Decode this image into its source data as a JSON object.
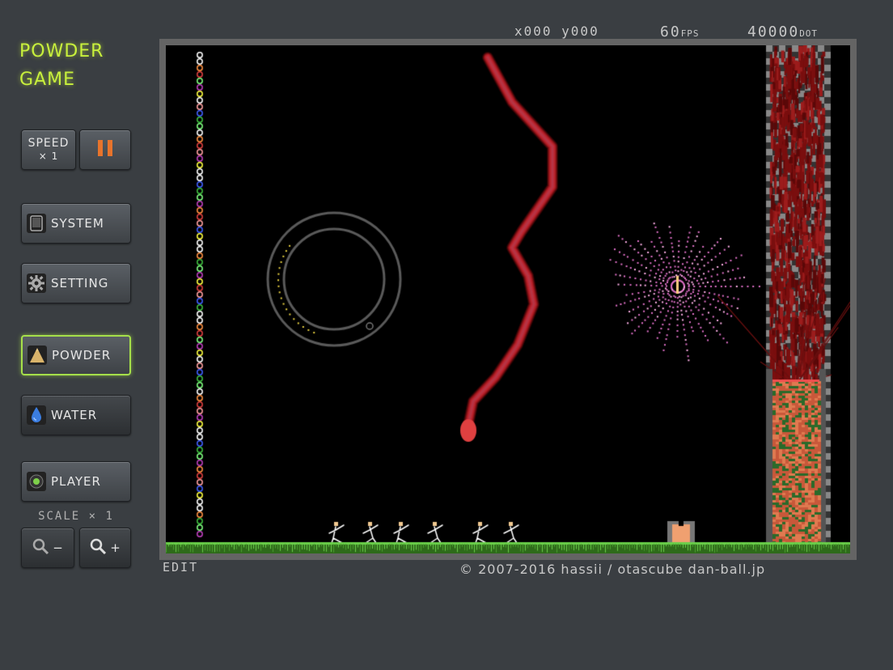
{
  "logo": {
    "line1": "POWDER",
    "line2": "GAME"
  },
  "hud": {
    "coords": "x000 y000",
    "fps_value": "60",
    "fps_unit": "FPS",
    "dot_value": "40000",
    "dot_unit": "DOT"
  },
  "buttons": {
    "speed_label": "SPEED",
    "speed_mult": "× 1",
    "system": "SYSTEM",
    "setting": "SETTING",
    "powder": "POWDER",
    "water": "WATER",
    "player": "PLAYER",
    "zoom_out": "−",
    "zoom_in": "+"
  },
  "scale": "SCALE × 1",
  "footer": {
    "edit": "EDIT",
    "copyright": "© 2007-2016 hassii / otascube  dan-ball.jp"
  },
  "colors": {
    "accent": "#a6e04a",
    "logo": "#c8f03c",
    "pause": "#e8742c"
  },
  "icons": [
    "tablet-icon",
    "gear-icon",
    "powder-pile-icon",
    "water-drop-icon",
    "player-dot-icon",
    "zoom-out-icon",
    "zoom-in-icon",
    "pause-icon"
  ]
}
